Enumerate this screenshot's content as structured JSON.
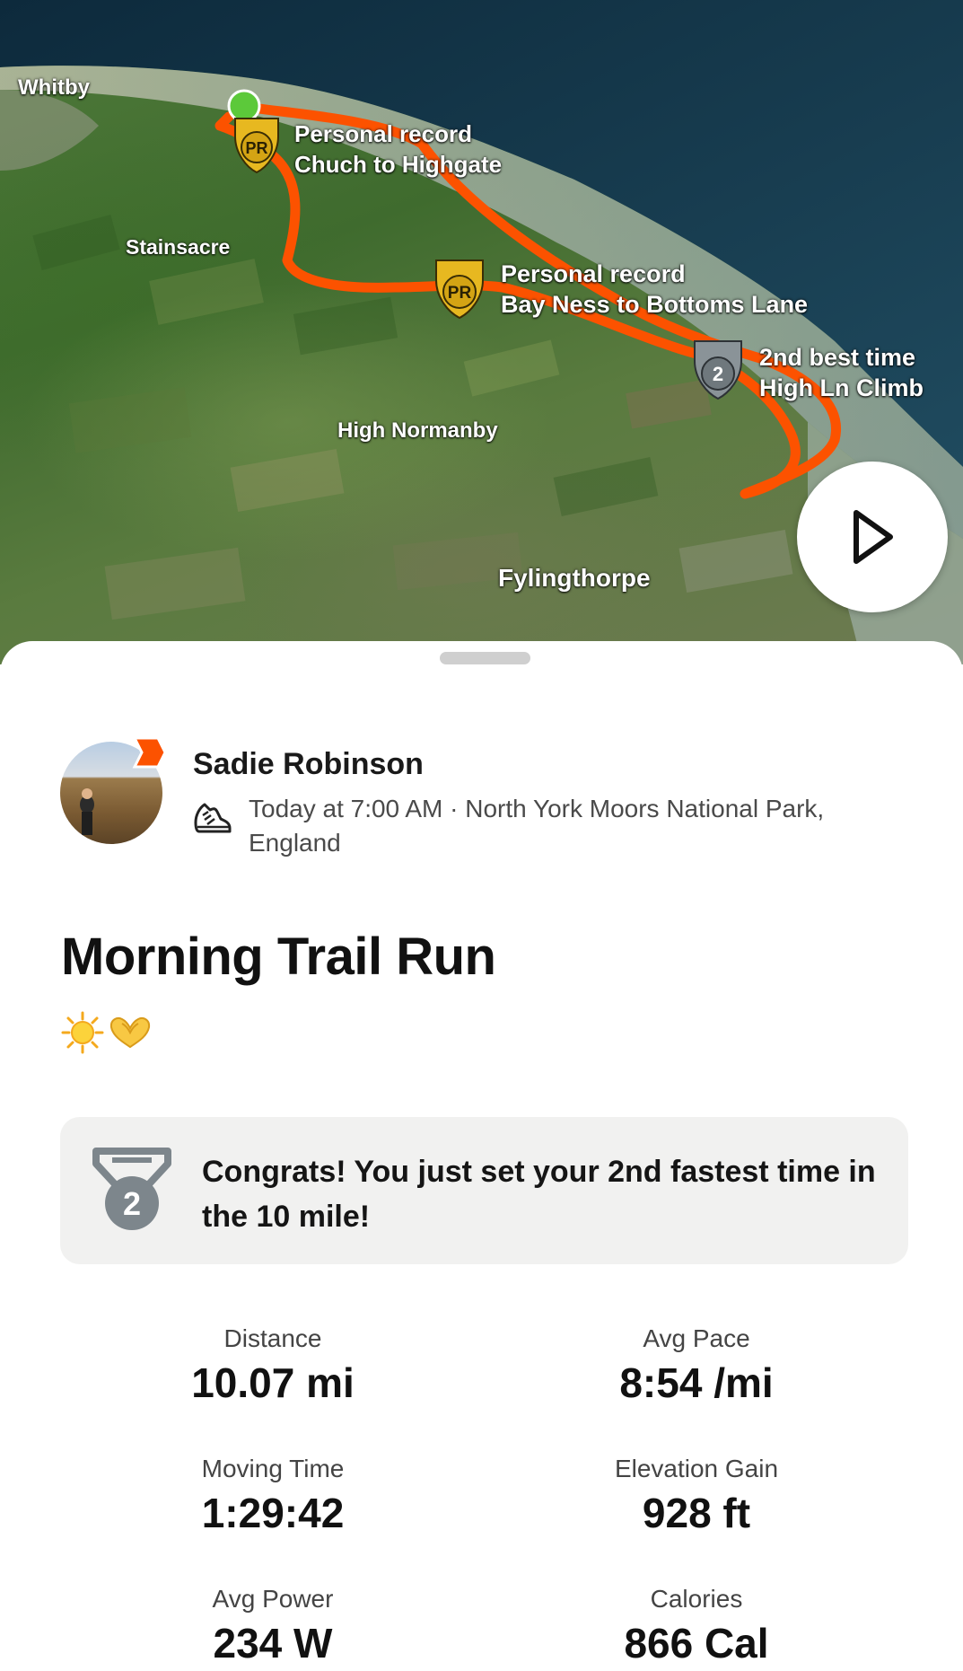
{
  "map": {
    "places": {
      "whitby": "Whitby",
      "stainsacre": "Stainsacre",
      "high_normanby": "High Normanby",
      "fylingthorpe": "Fylingthorpe"
    },
    "segments": [
      {
        "badge": "PR",
        "line1": "Personal record",
        "line2": "Chuch to Highgate"
      },
      {
        "badge": "PR",
        "line1": "Personal record",
        "line2": "Bay Ness to Bottoms Lane"
      },
      {
        "badge": "2",
        "line1": "2nd best time",
        "line2": "High Ln Climb"
      }
    ],
    "route_color": "#fc5200",
    "start_color": "#5cc93a",
    "play_icon": "play-icon"
  },
  "activity": {
    "athlete_name": "Sadie Robinson",
    "meta": "Today at 7:00 AM · North York Moors National Park, England",
    "sport_icon": "running-shoe-icon",
    "title": "Morning Trail Run",
    "emojis": [
      "sun-emoji",
      "heart-hands-emoji"
    ]
  },
  "achievement": {
    "icon": "2nd-place-medal-icon",
    "message": "Congrats! You just set your 2nd fastest time in the 10 mile!"
  },
  "stats": [
    {
      "label": "Distance",
      "value": "10.07 mi"
    },
    {
      "label": "Avg Pace",
      "value": "8:54 /mi"
    },
    {
      "label": "Moving Time",
      "value": "1:29:42"
    },
    {
      "label": "Elevation Gain",
      "value": "928 ft"
    },
    {
      "label": "Avg Power",
      "value": "234 W"
    },
    {
      "label": "Calories",
      "value": "866 Cal"
    }
  ],
  "colors": {
    "accent": "#fc5200",
    "pr_gold": "#e7b820",
    "medal_gray": "#7d868c",
    "card_bg": "#f1f1f0"
  }
}
